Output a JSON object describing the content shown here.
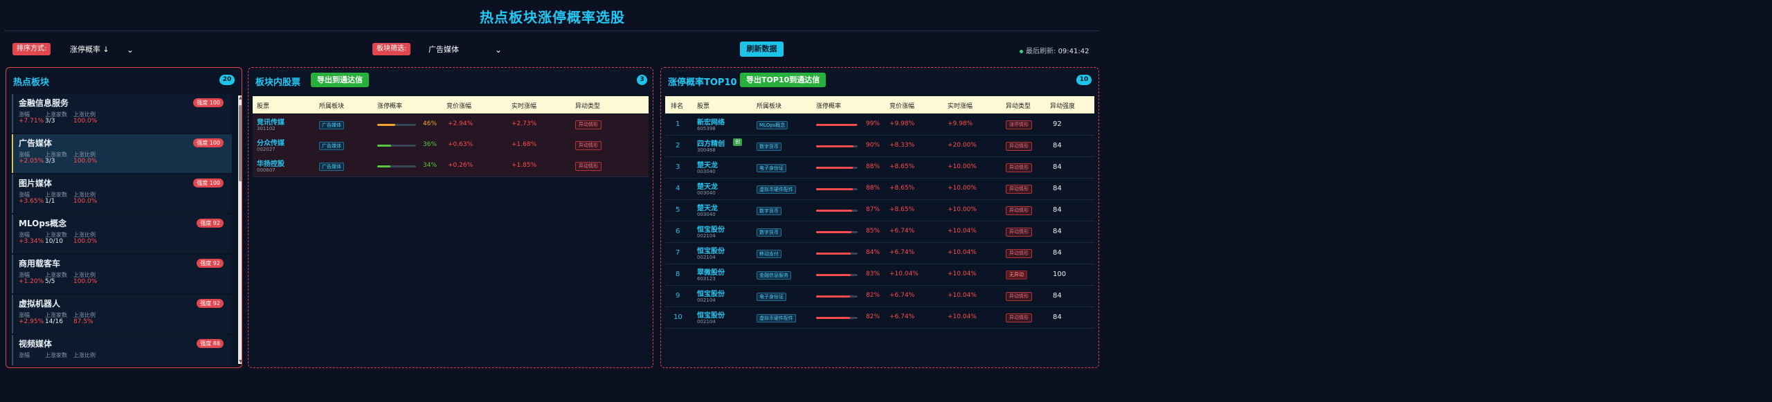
{
  "title": "热点板块涨停概率选股",
  "toolbar": {
    "sort_label": "排序方式:",
    "sort_value": "涨停概率 ↓",
    "filter_label": "板块筛选:",
    "filter_value": "广告媒体",
    "refresh_button": "刷新数据",
    "last_refresh_label": "最后刷新:",
    "last_refresh_time": "09:41:42"
  },
  "hot_sectors": {
    "title": "热点板块",
    "count": "20",
    "labels": {
      "change": "涨幅",
      "up_count": "上涨家数",
      "up_ratio": "上涨比例"
    },
    "items": [
      {
        "name": "金融信息服务",
        "badge": "强度 100",
        "change": "+7.71%",
        "up_count": "3/3",
        "up_ratio": "100.0%",
        "active": false
      },
      {
        "name": "广告媒体",
        "badge": "强度 100",
        "change": "+2.05%",
        "up_count": "3/3",
        "up_ratio": "100.0%",
        "active": true
      },
      {
        "name": "图片媒体",
        "badge": "强度 100",
        "change": "+3.65%",
        "up_count": "1/1",
        "up_ratio": "100.0%",
        "active": false
      },
      {
        "name": "MLOps概念",
        "badge": "强度 92",
        "change": "+3.34%",
        "up_count": "10/10",
        "up_ratio": "100.0%",
        "active": false
      },
      {
        "name": "商用载客车",
        "badge": "强度 92",
        "change": "+1.20%",
        "up_count": "5/5",
        "up_ratio": "100.0%",
        "active": false
      },
      {
        "name": "虚拟机器人",
        "badge": "强度 92",
        "change": "+2.95%",
        "up_count": "14/16",
        "up_ratio": "87.5%",
        "active": false
      },
      {
        "name": "视频媒体",
        "badge": "强度 88",
        "change": "",
        "up_count": "",
        "up_ratio": "",
        "active": false
      }
    ]
  },
  "sector_stocks": {
    "title": "板块内股票",
    "export_button": "导出到通达信",
    "count": "3",
    "columns": [
      "股票",
      "所属板块",
      "涨停概率",
      "竞价涨幅",
      "实时涨幅",
      "异动类型"
    ],
    "rows": [
      {
        "name": "竞讯传媒",
        "code": "301102",
        "sector": "广告媒体",
        "prob": 46,
        "prob_text": "46%",
        "bid": "+2.94%",
        "realtime": "+2.73%",
        "type": "异动情形",
        "color": "#f0a32a"
      },
      {
        "name": "分众传媒",
        "code": "002027",
        "sector": "广告媒体",
        "prob": 36,
        "prob_text": "36%",
        "bid": "+0.63%",
        "realtime": "+1.68%",
        "type": "异动情形",
        "color": "#59c93c"
      },
      {
        "name": "华扬控股",
        "code": "000607",
        "sector": "广告媒体",
        "prob": 34,
        "prob_text": "34%",
        "bid": "+0.26%",
        "realtime": "+1.85%",
        "type": "异动情形",
        "color": "#59c93c"
      }
    ]
  },
  "top10": {
    "title": "涨停概率TOP10",
    "export_button": "导出TOP10到通达信",
    "count": "10",
    "columns": [
      "排名",
      "股票",
      "所属板块",
      "涨停概率",
      "竞价涨幅",
      "实时涨幅",
      "异动类型",
      "异动强度"
    ],
    "rows": [
      {
        "rank": "1",
        "name": "新宏网络",
        "code": "605398",
        "tag": "",
        "sector": "MLOps概念",
        "prob": 99,
        "prob_text": "99%",
        "bid": "+9.98%",
        "realtime": "+9.98%",
        "type": "涨停情形",
        "strength": "92"
      },
      {
        "rank": "2",
        "name": "四方精创",
        "code": "300468",
        "tag": "创",
        "sector": "数字货币",
        "prob": 90,
        "prob_text": "90%",
        "bid": "+8.33%",
        "realtime": "+20.00%",
        "type": "异动情形",
        "strength": "84"
      },
      {
        "rank": "3",
        "name": "楚天龙",
        "code": "003040",
        "tag": "",
        "sector": "电子身份证",
        "prob": 88,
        "prob_text": "88%",
        "bid": "+8.65%",
        "realtime": "+10.00%",
        "type": "异动情形",
        "strength": "84"
      },
      {
        "rank": "4",
        "name": "楚天龙",
        "code": "003040",
        "tag": "",
        "sector": "虚拟币硬件配件",
        "prob": 88,
        "prob_text": "88%",
        "bid": "+8.65%",
        "realtime": "+10.00%",
        "type": "异动情形",
        "strength": "84"
      },
      {
        "rank": "5",
        "name": "楚天龙",
        "code": "003040",
        "tag": "",
        "sector": "数字货币",
        "prob": 87,
        "prob_text": "87%",
        "bid": "+8.65%",
        "realtime": "+10.00%",
        "type": "异动情形",
        "strength": "84"
      },
      {
        "rank": "6",
        "name": "恒宝股份",
        "code": "002104",
        "tag": "",
        "sector": "数字货币",
        "prob": 85,
        "prob_text": "85%",
        "bid": "+6.74%",
        "realtime": "+10.04%",
        "type": "异动情形",
        "strength": "84"
      },
      {
        "rank": "7",
        "name": "恒宝股份",
        "code": "002104",
        "tag": "",
        "sector": "移动支付",
        "prob": 84,
        "prob_text": "84%",
        "bid": "+6.74%",
        "realtime": "+10.04%",
        "type": "异动情形",
        "strength": "84"
      },
      {
        "rank": "8",
        "name": "翠微股份",
        "code": "603123",
        "tag": "",
        "sector": "金融信息服务",
        "prob": 83,
        "prob_text": "83%",
        "bid": "+10.04%",
        "realtime": "+10.04%",
        "type": "无异动",
        "strength": "100"
      },
      {
        "rank": "9",
        "name": "恒宝股份",
        "code": "002104",
        "tag": "",
        "sector": "电子身份证",
        "prob": 82,
        "prob_text": "82%",
        "bid": "+6.74%",
        "realtime": "+10.04%",
        "type": "异动情形",
        "strength": "84"
      },
      {
        "rank": "10",
        "name": "恒宝股份",
        "code": "002104",
        "tag": "",
        "sector": "虚拟币硬件配件",
        "prob": 82,
        "prob_text": "82%",
        "bid": "+6.74%",
        "realtime": "+10.04%",
        "type": "异动情形",
        "strength": "84"
      }
    ]
  },
  "colors": {
    "accent": "#22c8f5",
    "up": "#ff4d4f",
    "badge": "#e0474f",
    "green": "#27b03c",
    "header_bg": "#fff9d6"
  }
}
